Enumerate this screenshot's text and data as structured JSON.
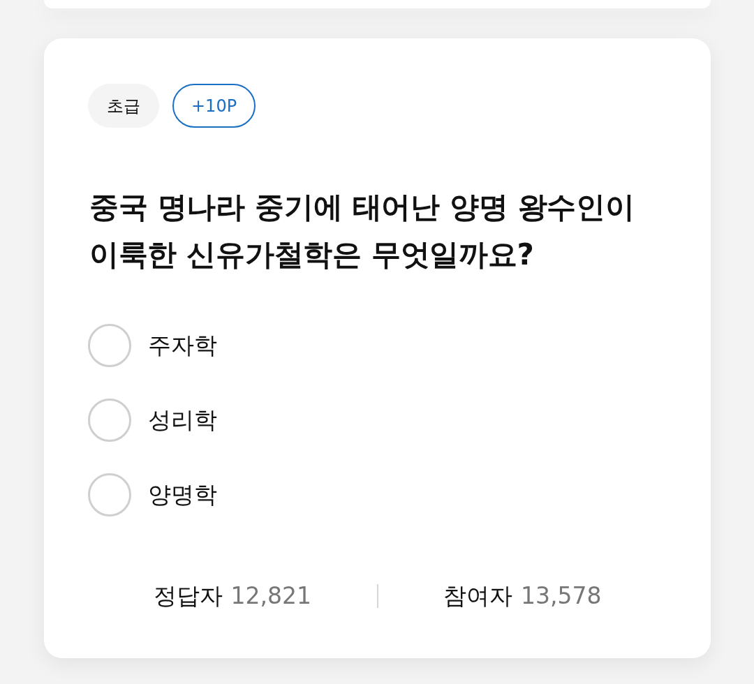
{
  "quiz": {
    "tags": [
      {
        "kind": "level",
        "label": "초급"
      },
      {
        "kind": "points",
        "label": "+10P"
      }
    ],
    "question": "중국 명나라 중기에 태어난 양명 왕수인이 이룩한 신유가철학은 무엇일까요?",
    "options": [
      {
        "label": "주자학",
        "selected": false
      },
      {
        "label": "성리학",
        "selected": false
      },
      {
        "label": "양명학",
        "selected": false
      }
    ],
    "stats": [
      {
        "label": "정답자",
        "value": "12,821"
      },
      {
        "label": "참여자",
        "value": "13,578"
      }
    ]
  }
}
